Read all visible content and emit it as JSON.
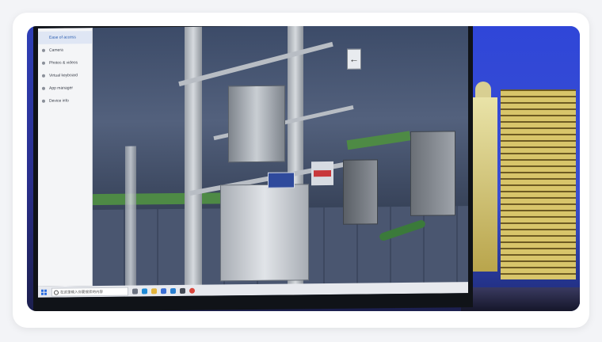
{
  "settings_panel": {
    "items": [
      {
        "label": "Ease of access",
        "active": true
      },
      {
        "label": "Camera",
        "active": false
      },
      {
        "label": "Photos & videos",
        "active": false
      },
      {
        "label": "Virtual keyboard",
        "active": false
      },
      {
        "label": "App manager",
        "active": false
      },
      {
        "label": "Device info",
        "active": false
      }
    ]
  },
  "taskbar": {
    "search_placeholder": "在这里输入你要搜索的内容",
    "icons": [
      "task-view-icon",
      "edge-icon",
      "file-explorer-icon",
      "store-icon",
      "mail-icon",
      "app-icon",
      "chrome-icon"
    ]
  },
  "scene": {
    "arrow_sign": "←"
  },
  "colors": {
    "city_sky": "#2f46d8",
    "building_lights": "#d8c56a",
    "taskbar_bg": "#e7e9ee",
    "accent_blue": "#2b6de0"
  }
}
